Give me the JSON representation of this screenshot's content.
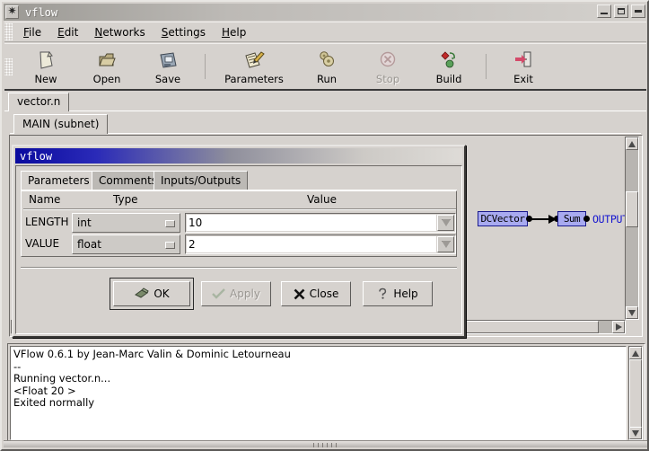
{
  "window": {
    "title": "vflow",
    "icon": "app-icon",
    "controls": [
      {
        "name": "minimize-button",
        "label": "minimize"
      },
      {
        "name": "maximize-button",
        "label": "maximize"
      },
      {
        "name": "close-button",
        "label": "close"
      }
    ]
  },
  "menubar": {
    "items": [
      {
        "label": "File",
        "mnemonic": "F"
      },
      {
        "label": "Edit",
        "mnemonic": "E"
      },
      {
        "label": "Networks",
        "mnemonic": "N"
      },
      {
        "label": "Settings",
        "mnemonic": "S"
      },
      {
        "label": "Help",
        "mnemonic": "H"
      }
    ]
  },
  "toolbar": {
    "buttons": [
      {
        "label": "New",
        "icon": "new-document-icon",
        "disabled": false
      },
      {
        "label": "Open",
        "icon": "open-folder-icon",
        "disabled": false
      },
      {
        "label": "Save",
        "icon": "floppy-disk-icon",
        "disabled": false
      },
      {
        "label": "Parameters",
        "icon": "parameters-pencil-icon",
        "disabled": false
      },
      {
        "label": "Run",
        "icon": "run-gears-icon",
        "disabled": false
      },
      {
        "label": "Stop",
        "icon": "stop-circle-icon",
        "disabled": true
      },
      {
        "label": "Build",
        "icon": "build-shapes-icon",
        "disabled": false
      },
      {
        "label": "Exit",
        "icon": "exit-door-icon",
        "disabled": false
      }
    ]
  },
  "file_tabs": [
    {
      "label": "vector.n",
      "selected": true
    }
  ],
  "sub_tabs": [
    {
      "label": "MAIN (subnet)",
      "selected": true
    }
  ],
  "canvas": {
    "nodes": [
      {
        "id": "dcvector",
        "label": "DCVector"
      },
      {
        "id": "sum",
        "label": "Sum"
      }
    ],
    "output_label": "OUTPUT"
  },
  "dialog": {
    "title": "vflow",
    "tabs": [
      {
        "label": "Parameters",
        "selected": true
      },
      {
        "label": "Comments",
        "selected": false
      },
      {
        "label": "Inputs/Outputs",
        "selected": false
      }
    ],
    "columns": {
      "name": "Name",
      "type": "Type",
      "value": "Value"
    },
    "rows": [
      {
        "name": "LENGTH",
        "type": "int",
        "value": "10"
      },
      {
        "name": "VALUE",
        "type": "float",
        "value": "2"
      }
    ],
    "buttons": [
      {
        "label": "OK",
        "icon": "ok-hand-icon",
        "disabled": false,
        "focused": true
      },
      {
        "label": "Apply",
        "icon": "apply-check-icon",
        "disabled": true,
        "focused": false
      },
      {
        "label": "Close",
        "icon": "close-x-icon",
        "disabled": false,
        "focused": false
      },
      {
        "label": "Help",
        "icon": "help-question-icon",
        "disabled": false,
        "focused": false
      }
    ]
  },
  "log": {
    "lines": [
      "VFlow 0.6.1 by Jean-Marc Valin & Dominic Letourneau",
      "--",
      "Running vector.n...",
      "<Float 20 >",
      "Exited normally"
    ]
  },
  "colors": {
    "face": "#d6d2ce",
    "node_fill": "#a8aaf0",
    "node_border": "#1a1a8c",
    "output_text": "#1515d0",
    "titlebar_active": "#0a0a9e"
  }
}
